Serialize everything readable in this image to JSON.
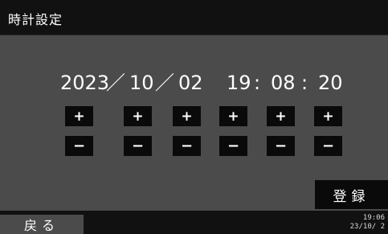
{
  "header": {
    "title": "時計設定"
  },
  "datetime": {
    "year": "2023",
    "sep1": "／",
    "month": "10",
    "sep2": "／",
    "day": "02",
    "hour": "19",
    "sep3": ":",
    "minute": "08",
    "sep4": ":",
    "second": "20"
  },
  "controls": {
    "plus_label": "+",
    "minus_label": "−"
  },
  "actions": {
    "register_label": "登録",
    "back_label": "戻る"
  },
  "status": {
    "time": "19:06",
    "date": "23/10/ 2"
  }
}
